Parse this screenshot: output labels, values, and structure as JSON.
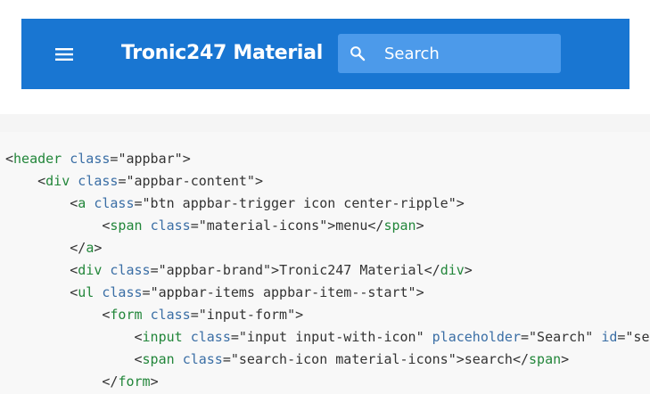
{
  "appbar": {
    "menu_icon": "menu-icon",
    "brand": "Tronic247 Material",
    "search": {
      "placeholder": "Search",
      "icon": "search-icon"
    },
    "colors": {
      "background": "#1976d2",
      "search_background": "#4c9aea",
      "text": "#ffffff"
    }
  },
  "code": {
    "lines": [
      {
        "indent": 0,
        "tokens": [
          [
            "punct",
            "<"
          ],
          [
            "tag",
            "header"
          ],
          [
            "punct",
            " "
          ],
          [
            "attr",
            "class"
          ],
          [
            "punct",
            "="
          ],
          [
            "val",
            "\"appbar\""
          ],
          [
            "punct",
            ">"
          ]
        ]
      },
      {
        "indent": 1,
        "tokens": [
          [
            "punct",
            "<"
          ],
          [
            "tag",
            "div"
          ],
          [
            "punct",
            " "
          ],
          [
            "attr",
            "class"
          ],
          [
            "punct",
            "="
          ],
          [
            "val",
            "\"appbar-content\""
          ],
          [
            "punct",
            ">"
          ]
        ]
      },
      {
        "indent": 2,
        "tokens": [
          [
            "punct",
            "<"
          ],
          [
            "tag",
            "a"
          ],
          [
            "punct",
            " "
          ],
          [
            "attr",
            "class"
          ],
          [
            "punct",
            "="
          ],
          [
            "val",
            "\"btn appbar-trigger icon center-ripple\""
          ],
          [
            "punct",
            ">"
          ]
        ]
      },
      {
        "indent": 3,
        "tokens": [
          [
            "punct",
            "<"
          ],
          [
            "tag",
            "span"
          ],
          [
            "punct",
            " "
          ],
          [
            "attr",
            "class"
          ],
          [
            "punct",
            "="
          ],
          [
            "val",
            "\"material-icons\""
          ],
          [
            "punct",
            ">"
          ],
          [
            "txt",
            "menu"
          ],
          [
            "punct",
            "</"
          ],
          [
            "tag",
            "span"
          ],
          [
            "punct",
            ">"
          ]
        ]
      },
      {
        "indent": 2,
        "tokens": [
          [
            "punct",
            "</"
          ],
          [
            "tag",
            "a"
          ],
          [
            "punct",
            ">"
          ]
        ]
      },
      {
        "indent": 2,
        "tokens": [
          [
            "punct",
            "<"
          ],
          [
            "tag",
            "div"
          ],
          [
            "punct",
            " "
          ],
          [
            "attr",
            "class"
          ],
          [
            "punct",
            "="
          ],
          [
            "val",
            "\"appbar-brand\""
          ],
          [
            "punct",
            ">"
          ],
          [
            "txt",
            "Tronic247 Material"
          ],
          [
            "punct",
            "</"
          ],
          [
            "tag",
            "div"
          ],
          [
            "punct",
            ">"
          ]
        ]
      },
      {
        "indent": 2,
        "tokens": [
          [
            "punct",
            "<"
          ],
          [
            "tag",
            "ul"
          ],
          [
            "punct",
            " "
          ],
          [
            "attr",
            "class"
          ],
          [
            "punct",
            "="
          ],
          [
            "val",
            "\"appbar-items appbar-item--start\""
          ],
          [
            "punct",
            ">"
          ]
        ]
      },
      {
        "indent": 3,
        "tokens": [
          [
            "punct",
            "<"
          ],
          [
            "tag",
            "form"
          ],
          [
            "punct",
            " "
          ],
          [
            "attr",
            "class"
          ],
          [
            "punct",
            "="
          ],
          [
            "val",
            "\"input-form\""
          ],
          [
            "punct",
            ">"
          ]
        ]
      },
      {
        "indent": 4,
        "tokens": [
          [
            "punct",
            "<"
          ],
          [
            "tag",
            "input"
          ],
          [
            "punct",
            " "
          ],
          [
            "attr",
            "class"
          ],
          [
            "punct",
            "="
          ],
          [
            "val",
            "\"input input-with-icon\""
          ],
          [
            "punct",
            " "
          ],
          [
            "attr",
            "placeholder"
          ],
          [
            "punct",
            "="
          ],
          [
            "val",
            "\"Search\""
          ],
          [
            "punct",
            " "
          ],
          [
            "attr",
            "id"
          ],
          [
            "punct",
            "="
          ],
          [
            "val",
            "\"search\""
          ],
          [
            "punct",
            ">"
          ]
        ]
      },
      {
        "indent": 4,
        "tokens": [
          [
            "punct",
            "<"
          ],
          [
            "tag",
            "span"
          ],
          [
            "punct",
            " "
          ],
          [
            "attr",
            "class"
          ],
          [
            "punct",
            "="
          ],
          [
            "val",
            "\"search-icon material-icons\""
          ],
          [
            "punct",
            ">"
          ],
          [
            "txt",
            "search"
          ],
          [
            "punct",
            "</"
          ],
          [
            "tag",
            "span"
          ],
          [
            "punct",
            ">"
          ]
        ]
      },
      {
        "indent": 3,
        "tokens": [
          [
            "punct",
            "</"
          ],
          [
            "tag",
            "form"
          ],
          [
            "punct",
            ">"
          ]
        ]
      }
    ]
  }
}
